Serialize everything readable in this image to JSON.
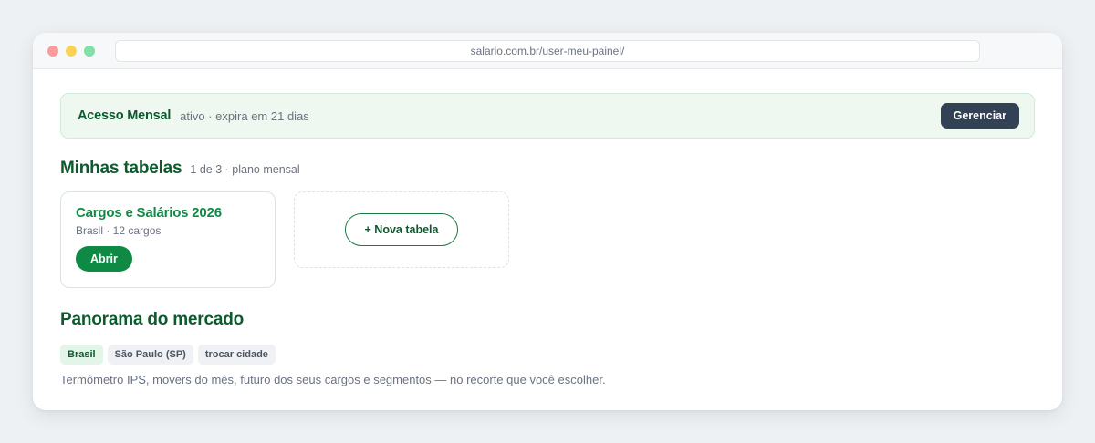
{
  "browser": {
    "url": "salario.com.br/user-meu-painel/"
  },
  "access": {
    "title": "Acesso Mensal",
    "status": "ativo · expira em 21 dias",
    "manage_label": "Gerenciar"
  },
  "tables": {
    "title": "Minhas tabelas",
    "subtitle": "1 de 3 · plano mensal",
    "items": [
      {
        "name": "Cargos e Salários 2026",
        "meta": "Brasil · 12 cargos",
        "open_label": "Abrir"
      }
    ],
    "new_label": "+ Nova tabela"
  },
  "market": {
    "title": "Panorama do mercado",
    "chips": [
      {
        "label": "Brasil",
        "active": true
      },
      {
        "label": "São Paulo (SP)",
        "active": false
      },
      {
        "label": "trocar cidade",
        "active": false
      }
    ],
    "description": "Termômetro IPS, movers do mês, futuro dos seus cargos e segmentos — no recorte que você escolher."
  },
  "colors": {
    "brand_green": "#0c5a2e",
    "accent_green": "#0f8a45",
    "dark_button": "#334155"
  }
}
